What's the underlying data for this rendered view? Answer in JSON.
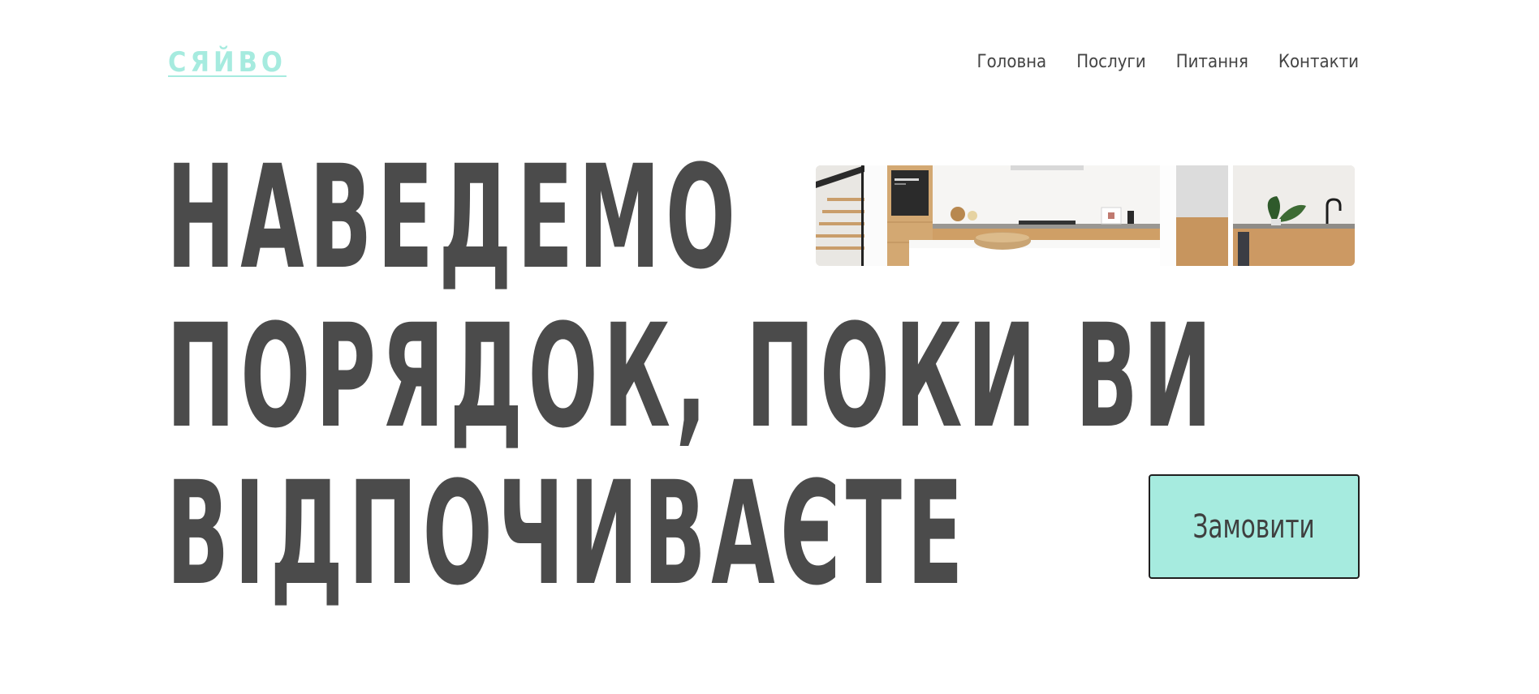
{
  "header": {
    "logo": "СЯЙВО",
    "nav": [
      "Головна",
      "Послуги",
      "Питання",
      "Контакти"
    ]
  },
  "hero": {
    "lines": [
      "НАВЕДЕМО",
      "ПОРЯДОК, ПОКИ ВИ",
      "ВІДПОЧИВАЄТЕ"
    ],
    "image_icon": "kitchen-photo",
    "cta_label": "Замовити"
  },
  "colors": {
    "accent": "#a6ebdf",
    "text": "#4b4b4b",
    "background": "#ffffff"
  }
}
